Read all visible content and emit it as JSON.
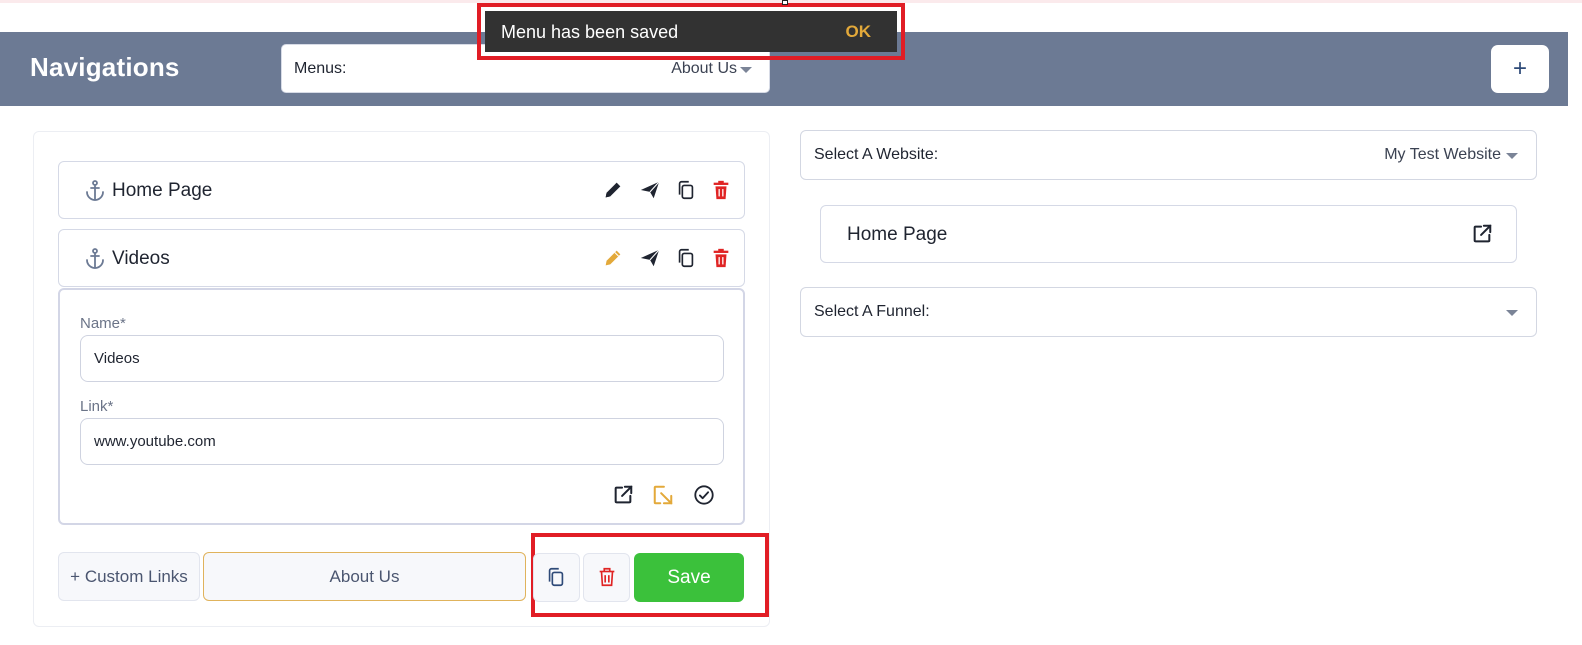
{
  "header": {
    "title": "Navigations",
    "menus_label": "Menus:",
    "menus_value": "About Us",
    "add_label": "+"
  },
  "toast": {
    "message": "Menu has been saved",
    "action": "OK"
  },
  "menu_items": [
    {
      "name": "Home Page"
    },
    {
      "name": "Videos"
    }
  ],
  "edit_form": {
    "name_label": "Name*",
    "name_value": "Videos",
    "link_label": "Link*",
    "link_value": "www.youtube.com"
  },
  "footer": {
    "custom_links_label": "+ Custom Links",
    "menu_name": "About Us",
    "save_label": "Save"
  },
  "website": {
    "label": "Select A Website:",
    "value": "My Test Website",
    "pages": [
      {
        "name": "Home Page"
      }
    ]
  },
  "funnel": {
    "label": "Select A Funnel:",
    "value": ""
  },
  "colors": {
    "header_bg": "#6c7a94",
    "save_green": "#3bc13b",
    "delete_red": "#e02424",
    "edit_active_orange": "#e3a93a",
    "highlight_red": "#e11d25"
  },
  "icons": [
    "anchor-icon",
    "pencil-icon",
    "send-icon",
    "copy-icon",
    "trash-icon",
    "external-link-icon",
    "arrow-down-right-icon",
    "check-circle-icon"
  ]
}
